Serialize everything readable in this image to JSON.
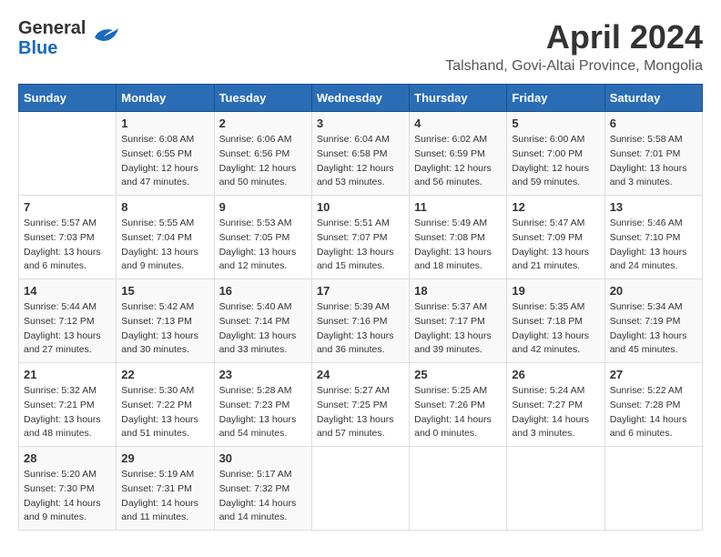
{
  "header": {
    "logo_general": "General",
    "logo_blue": "Blue",
    "title": "April 2024",
    "subtitle": "Talshand, Govi-Altai Province, Mongolia"
  },
  "columns": [
    "Sunday",
    "Monday",
    "Tuesday",
    "Wednesday",
    "Thursday",
    "Friday",
    "Saturday"
  ],
  "weeks": [
    [
      {
        "day": "",
        "info": ""
      },
      {
        "day": "1",
        "info": "Sunrise: 6:08 AM\nSunset: 6:55 PM\nDaylight: 12 hours\nand 47 minutes."
      },
      {
        "day": "2",
        "info": "Sunrise: 6:06 AM\nSunset: 6:56 PM\nDaylight: 12 hours\nand 50 minutes."
      },
      {
        "day": "3",
        "info": "Sunrise: 6:04 AM\nSunset: 6:58 PM\nDaylight: 12 hours\nand 53 minutes."
      },
      {
        "day": "4",
        "info": "Sunrise: 6:02 AM\nSunset: 6:59 PM\nDaylight: 12 hours\nand 56 minutes."
      },
      {
        "day": "5",
        "info": "Sunrise: 6:00 AM\nSunset: 7:00 PM\nDaylight: 12 hours\nand 59 minutes."
      },
      {
        "day": "6",
        "info": "Sunrise: 5:58 AM\nSunset: 7:01 PM\nDaylight: 13 hours\nand 3 minutes."
      }
    ],
    [
      {
        "day": "7",
        "info": "Sunrise: 5:57 AM\nSunset: 7:03 PM\nDaylight: 13 hours\nand 6 minutes."
      },
      {
        "day": "8",
        "info": "Sunrise: 5:55 AM\nSunset: 7:04 PM\nDaylight: 13 hours\nand 9 minutes."
      },
      {
        "day": "9",
        "info": "Sunrise: 5:53 AM\nSunset: 7:05 PM\nDaylight: 13 hours\nand 12 minutes."
      },
      {
        "day": "10",
        "info": "Sunrise: 5:51 AM\nSunset: 7:07 PM\nDaylight: 13 hours\nand 15 minutes."
      },
      {
        "day": "11",
        "info": "Sunrise: 5:49 AM\nSunset: 7:08 PM\nDaylight: 13 hours\nand 18 minutes."
      },
      {
        "day": "12",
        "info": "Sunrise: 5:47 AM\nSunset: 7:09 PM\nDaylight: 13 hours\nand 21 minutes."
      },
      {
        "day": "13",
        "info": "Sunrise: 5:46 AM\nSunset: 7:10 PM\nDaylight: 13 hours\nand 24 minutes."
      }
    ],
    [
      {
        "day": "14",
        "info": "Sunrise: 5:44 AM\nSunset: 7:12 PM\nDaylight: 13 hours\nand 27 minutes."
      },
      {
        "day": "15",
        "info": "Sunrise: 5:42 AM\nSunset: 7:13 PM\nDaylight: 13 hours\nand 30 minutes."
      },
      {
        "day": "16",
        "info": "Sunrise: 5:40 AM\nSunset: 7:14 PM\nDaylight: 13 hours\nand 33 minutes."
      },
      {
        "day": "17",
        "info": "Sunrise: 5:39 AM\nSunset: 7:16 PM\nDaylight: 13 hours\nand 36 minutes."
      },
      {
        "day": "18",
        "info": "Sunrise: 5:37 AM\nSunset: 7:17 PM\nDaylight: 13 hours\nand 39 minutes."
      },
      {
        "day": "19",
        "info": "Sunrise: 5:35 AM\nSunset: 7:18 PM\nDaylight: 13 hours\nand 42 minutes."
      },
      {
        "day": "20",
        "info": "Sunrise: 5:34 AM\nSunset: 7:19 PM\nDaylight: 13 hours\nand 45 minutes."
      }
    ],
    [
      {
        "day": "21",
        "info": "Sunrise: 5:32 AM\nSunset: 7:21 PM\nDaylight: 13 hours\nand 48 minutes."
      },
      {
        "day": "22",
        "info": "Sunrise: 5:30 AM\nSunset: 7:22 PM\nDaylight: 13 hours\nand 51 minutes."
      },
      {
        "day": "23",
        "info": "Sunrise: 5:28 AM\nSunset: 7:23 PM\nDaylight: 13 hours\nand 54 minutes."
      },
      {
        "day": "24",
        "info": "Sunrise: 5:27 AM\nSunset: 7:25 PM\nDaylight: 13 hours\nand 57 minutes."
      },
      {
        "day": "25",
        "info": "Sunrise: 5:25 AM\nSunset: 7:26 PM\nDaylight: 14 hours\nand 0 minutes."
      },
      {
        "day": "26",
        "info": "Sunrise: 5:24 AM\nSunset: 7:27 PM\nDaylight: 14 hours\nand 3 minutes."
      },
      {
        "day": "27",
        "info": "Sunrise: 5:22 AM\nSunset: 7:28 PM\nDaylight: 14 hours\nand 6 minutes."
      }
    ],
    [
      {
        "day": "28",
        "info": "Sunrise: 5:20 AM\nSunset: 7:30 PM\nDaylight: 14 hours\nand 9 minutes."
      },
      {
        "day": "29",
        "info": "Sunrise: 5:19 AM\nSunset: 7:31 PM\nDaylight: 14 hours\nand 11 minutes."
      },
      {
        "day": "30",
        "info": "Sunrise: 5:17 AM\nSunset: 7:32 PM\nDaylight: 14 hours\nand 14 minutes."
      },
      {
        "day": "",
        "info": ""
      },
      {
        "day": "",
        "info": ""
      },
      {
        "day": "",
        "info": ""
      },
      {
        "day": "",
        "info": ""
      }
    ]
  ]
}
